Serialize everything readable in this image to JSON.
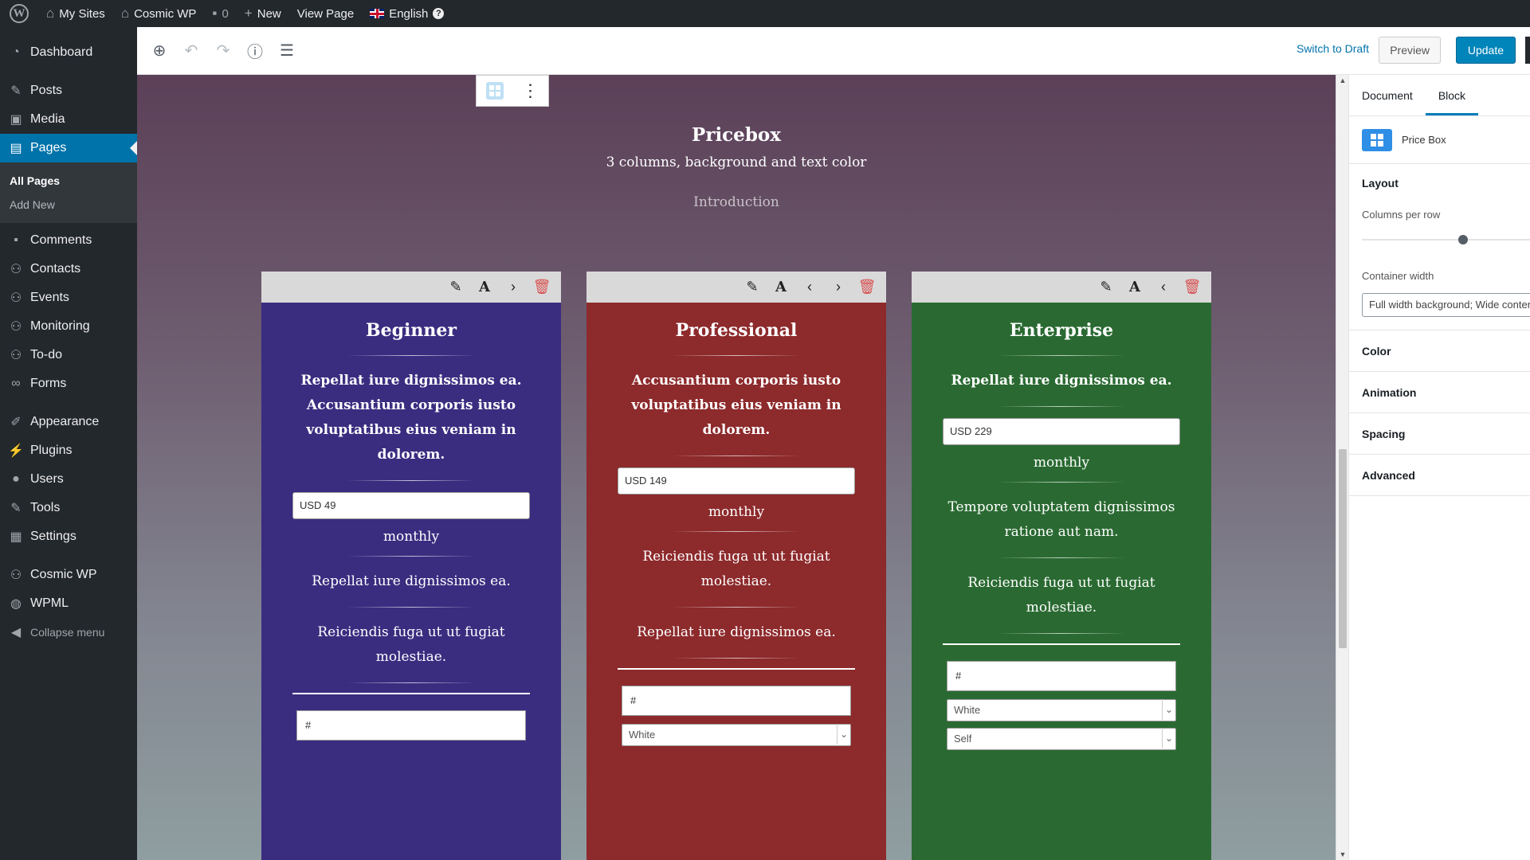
{
  "adminbar": {
    "my_sites": "My Sites",
    "site_name": "Cosmic WP",
    "comments_count": "0",
    "new": "New",
    "view_page": "View Page",
    "language": "English"
  },
  "sidebar": {
    "items": [
      {
        "label": "Dashboard",
        "icon": "dashboard-icon"
      },
      {
        "label": "Posts",
        "icon": "pin-icon"
      },
      {
        "label": "Media",
        "icon": "media-icon"
      },
      {
        "label": "Pages",
        "icon": "pages-icon"
      },
      {
        "label": "Comments",
        "icon": "comment-icon"
      },
      {
        "label": "Contacts",
        "icon": "contacts-icon"
      },
      {
        "label": "Events",
        "icon": "events-icon"
      },
      {
        "label": "Monitoring",
        "icon": "monitoring-icon"
      },
      {
        "label": "To-do",
        "icon": "todo-icon"
      },
      {
        "label": "Forms",
        "icon": "forms-icon"
      },
      {
        "label": "Appearance",
        "icon": "brush-icon"
      },
      {
        "label": "Plugins",
        "icon": "plugin-icon"
      },
      {
        "label": "Users",
        "icon": "user-icon"
      },
      {
        "label": "Tools",
        "icon": "wrench-icon"
      },
      {
        "label": "Settings",
        "icon": "settings-icon"
      },
      {
        "label": "Cosmic WP",
        "icon": "cosmic-icon"
      },
      {
        "label": "WPML",
        "icon": "wpml-icon"
      }
    ],
    "submenu": [
      "All Pages",
      "Add New"
    ],
    "collapse": "Collapse menu"
  },
  "toolbar": {
    "switch_to_draft": "Switch to Draft",
    "preview": "Preview",
    "update": "Update"
  },
  "page": {
    "title": "Pricebox",
    "subtitle": "3 columns, background and text color",
    "intro": "Introduction"
  },
  "columns": [
    {
      "name": "Beginner",
      "color": "#3a2d80",
      "description": "Repellat iure dignissimos ea. Accusantium corporis iusto voluptatibus eius veniam in dolorem.",
      "price": "USD 49",
      "period": "monthly",
      "features": [
        "Repellat iure dignissimos ea.",
        "Reiciendis fuga ut ut fugiat molestiae."
      ],
      "link": "#",
      "selects": []
    },
    {
      "name": "Professional",
      "color": "#8d2a2c",
      "description": "Accusantium corporis iusto voluptatibus eius veniam in dolorem.",
      "price": "USD 149",
      "period": "monthly",
      "features": [
        "Reiciendis fuga ut ut fugiat molestiae.",
        "Repellat iure dignissimos ea."
      ],
      "link": "#",
      "selects": [
        "White"
      ]
    },
    {
      "name": "Enterprise",
      "color": "#2a6a32",
      "description": "Repellat iure dignissimos ea.",
      "price": "USD 229",
      "period": "monthly",
      "features": [
        "Tempore voluptatem dignissimos ratione aut nam.",
        "Reiciendis fuga ut ut fugiat molestiae."
      ],
      "link": "#",
      "selects": [
        "White",
        "Self"
      ]
    }
  ],
  "settings": {
    "tabs": [
      "Document",
      "Block"
    ],
    "block_name": "Price Box",
    "layout_title": "Layout",
    "columns_per_row_label": "Columns per row",
    "columns_per_row_fraction": 0.65,
    "container_width_label": "Container width",
    "container_width_value": "Full width background; Wide content",
    "panels": [
      "Color",
      "Animation",
      "Spacing",
      "Advanced"
    ]
  }
}
